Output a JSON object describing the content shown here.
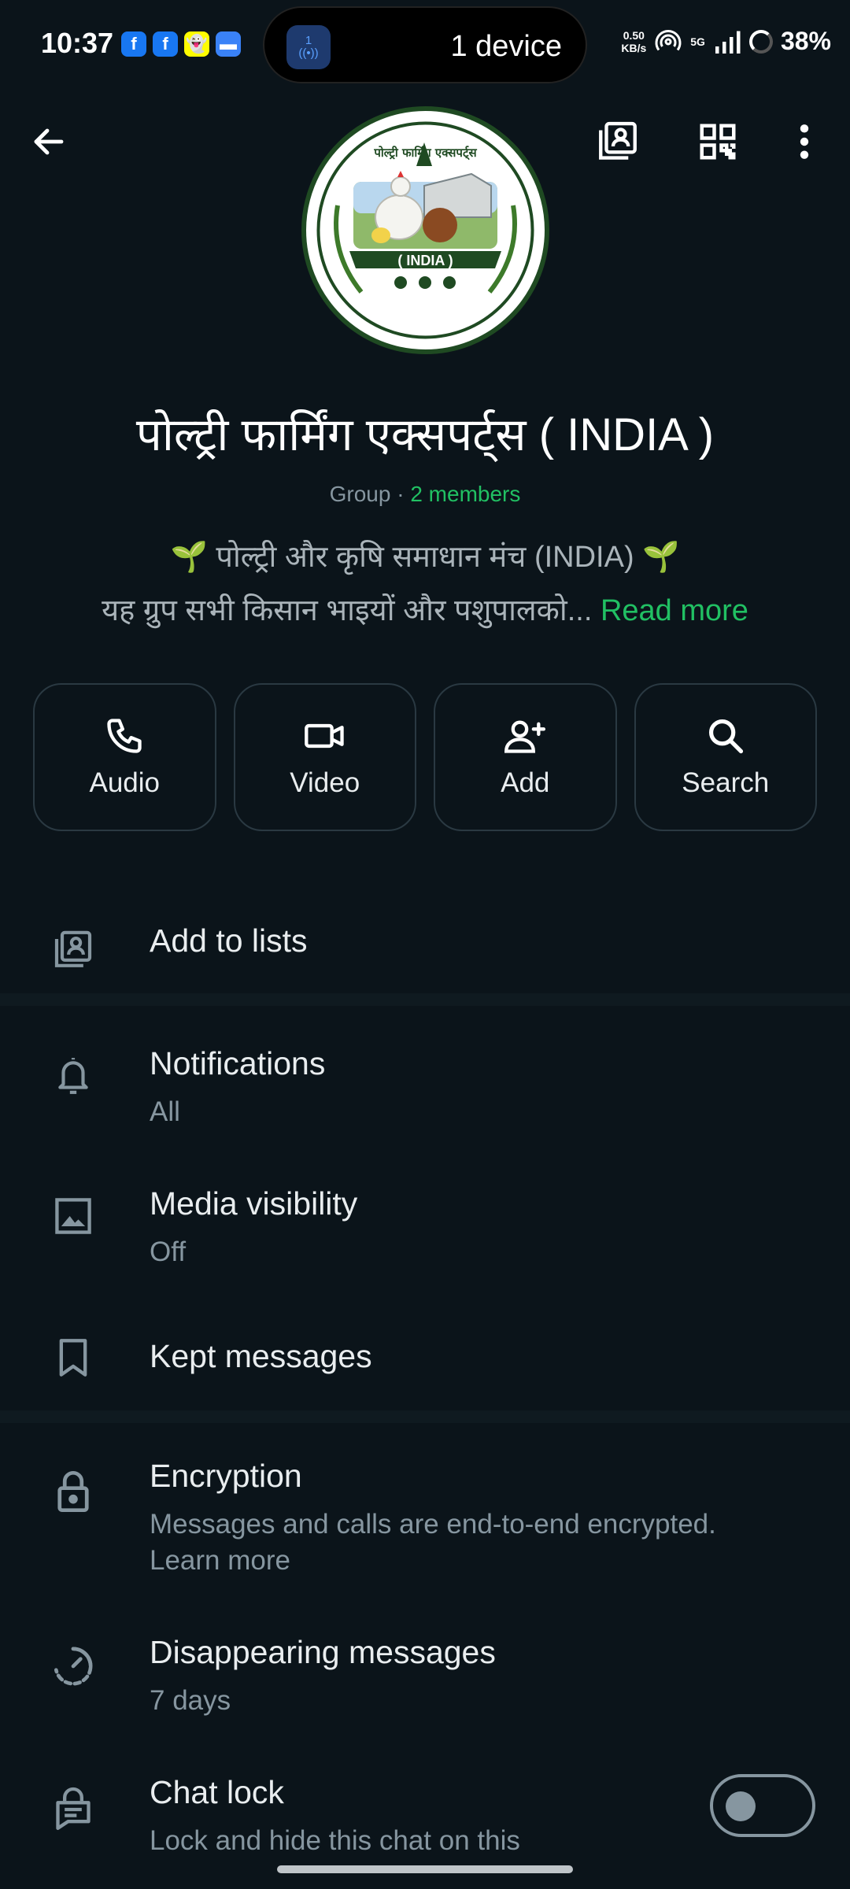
{
  "status_bar": {
    "time": "10:37",
    "island_badge": "1",
    "island_text": "1 device",
    "net_speed_value": "0.50",
    "net_speed_unit": "KB/s",
    "network": "5G",
    "battery": "38%"
  },
  "group": {
    "avatar_top_text": "पोल्ट्री फार्मिंग एक्सपर्ट्स",
    "avatar_banner": "( INDIA )",
    "name": "पोल्ट्री फार्मिंग एक्सपर्ट्स ( INDIA )",
    "type": "Group",
    "separator": " · ",
    "members": "2 members",
    "desc_line1": "🌱 पोल्ट्री और कृषि समाधान मंच (INDIA) 🌱",
    "desc_line2": "यह ग्रुप सभी किसान भाइयों और पशुपालको... ",
    "read_more": "Read more"
  },
  "actions": [
    {
      "label": "Audio",
      "icon": "phone-icon"
    },
    {
      "label": "Video",
      "icon": "video-icon"
    },
    {
      "label": "Add",
      "icon": "add-person-icon"
    },
    {
      "label": "Search",
      "icon": "search-icon"
    }
  ],
  "settings": {
    "add_to_lists": "Add to lists",
    "notifications": {
      "title": "Notifications",
      "value": "All"
    },
    "media_visibility": {
      "title": "Media visibility",
      "value": "Off"
    },
    "kept_messages": "Kept messages",
    "encryption": {
      "title": "Encryption",
      "line1": "Messages and calls are end-to-end encrypted.",
      "line2": "Learn more"
    },
    "disappearing": {
      "title": "Disappearing messages",
      "value": "7 days"
    },
    "chat_lock": {
      "title": "Chat lock",
      "value": "Lock and hide this chat on this",
      "enabled": false
    }
  },
  "colors": {
    "background": "#0b141a",
    "accent_green": "#21c063",
    "secondary_text": "#8696a0"
  }
}
